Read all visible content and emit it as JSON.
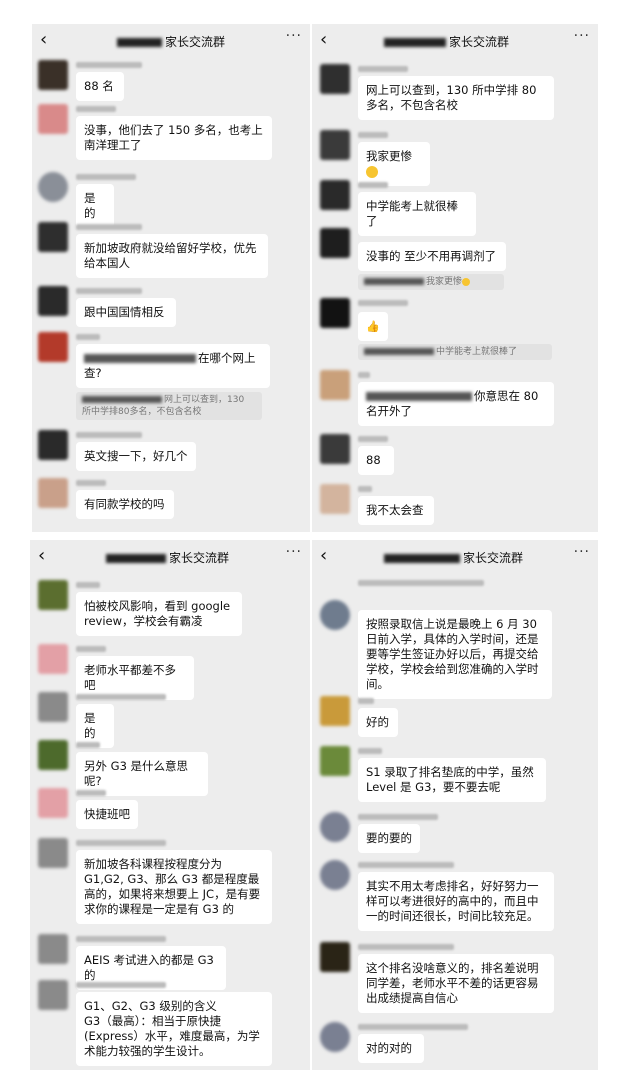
{
  "header": {
    "back_icon": "‹",
    "more_icon": "···",
    "title": "家长交流群"
  },
  "panel1": {
    "messages": [
      {
        "name": "某某家长",
        "text": "88 名"
      },
      {
        "name": "Poppinty",
        "text": "没事，他们去了 150 多名，也考上南洋理工了"
      },
      {
        "name": "某某家长",
        "text": "是的"
      },
      {
        "name": "某某家长",
        "text": "新加坡政府就没给留好学校，优先给本国人"
      },
      {
        "name": "某某家长",
        "text": "跟中国国情相反"
      },
      {
        "name": "某某",
        "text": "在哪个网上查?",
        "quote": "网上可以查到，130 所中学排80多名，不包含名校"
      },
      {
        "name": "某某家长",
        "text": "英文搜一下，好几个"
      },
      {
        "name": "某某",
        "text": "有同款学校的吗"
      }
    ]
  },
  "panel2": {
    "messages": [
      {
        "text": "网上可以查到，130 所中学排 80 多名，不包含名校"
      },
      {
        "text": "我家更惨"
      },
      {
        "text": "中学能考上就很棒了"
      },
      {
        "text": "没事的 至少不用再调剂了",
        "quote": "我家更惨"
      },
      {
        "text": "👍",
        "quote": "中学能考上就很棒了"
      },
      {
        "text": "你意思在 80 名开外了"
      },
      {
        "text": "88"
      },
      {
        "text": "我不太会查"
      }
    ]
  },
  "panel3": {
    "messages": [
      {
        "text": "怕被校风影响，看到 google review，学校会有霸凌"
      },
      {
        "text": "老师水平都差不多吧"
      },
      {
        "text": "是的"
      },
      {
        "text": "另外 G3 是什么意思呢?"
      },
      {
        "text": "快捷班吧"
      },
      {
        "text": "新加坡各科课程按程度分为 G1,G2, G3、那么 G3 都是程度最高的，如果将来想要上 JC，是有要求你的课程是一定是有 G3 的"
      },
      {
        "text": "AEIS 考试进入的都是 G3 的"
      },
      {
        "text": "G1、G2、G3 级别的含义\nG3（最高）：相当于原快捷(Express）水平，难度最高，为学术能力较强的学生设计。"
      }
    ]
  },
  "panel4": {
    "messages": [
      {
        "text": "按照录取信上说是最晚上 6 月 30 日前入学，具体的入学时间，还是要等学生签证办好以后，再提交给学校，学校会给到您准确的入学时间。"
      },
      {
        "text": "好的"
      },
      {
        "text": "S1 录取了排名垫底的中学，虽然 Level 是 G3，要不要去呢"
      },
      {
        "text": "要的要的"
      },
      {
        "text": "其实不用太考虑排名，好好努力一样可以考进很好的高中的，而且中一的时间还很长，时间比较充足。"
      },
      {
        "text": "这个排名没啥意义的，排名差说明同学差，老师水平不差的话更容易出成绩提高自信心"
      },
      {
        "text": "对的对的"
      }
    ]
  }
}
